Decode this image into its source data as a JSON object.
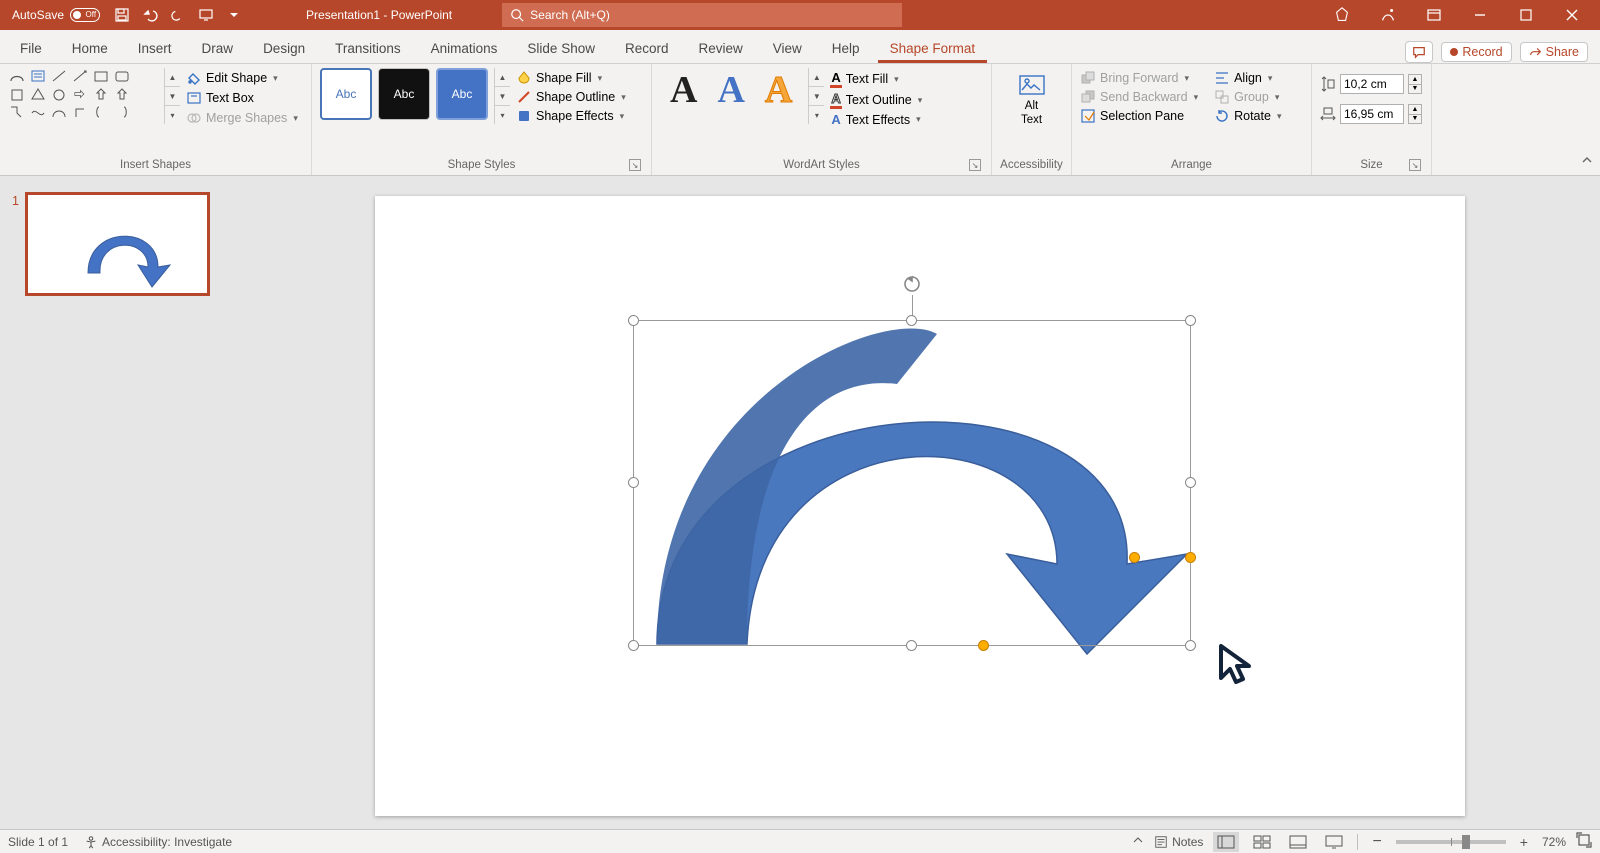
{
  "titlebar": {
    "autosave_label": "AutoSave",
    "autosave_state": "Off",
    "doc_title": "Presentation1 - PowerPoint",
    "search_placeholder": "Search (Alt+Q)"
  },
  "tabs": {
    "items": [
      "File",
      "Home",
      "Insert",
      "Draw",
      "Design",
      "Transitions",
      "Animations",
      "Slide Show",
      "Record",
      "Review",
      "View",
      "Help",
      "Shape Format"
    ],
    "active_index": 12,
    "comments_label": "",
    "record_label": "Record",
    "share_label": "Share"
  },
  "ribbon": {
    "insert_shapes": {
      "label": "Insert Shapes",
      "edit_shape": "Edit Shape",
      "text_box": "Text Box",
      "merge_shapes": "Merge Shapes"
    },
    "shape_styles": {
      "label": "Shape Styles",
      "swatch_text": "Abc",
      "shape_fill": "Shape Fill",
      "shape_outline": "Shape Outline",
      "shape_effects": "Shape Effects"
    },
    "wordart": {
      "label": "WordArt Styles",
      "text_fill": "Text Fill",
      "text_outline": "Text Outline",
      "text_effects": "Text Effects"
    },
    "accessibility": {
      "label": "Accessibility",
      "alt_text_1": "Alt",
      "alt_text_2": "Text"
    },
    "arrange": {
      "label": "Arrange",
      "bring_forward": "Bring Forward",
      "send_backward": "Send Backward",
      "selection_pane": "Selection Pane",
      "align": "Align",
      "group": "Group",
      "rotate": "Rotate"
    },
    "size": {
      "label": "Size",
      "height": "10,2 cm",
      "width": "16,95 cm"
    }
  },
  "thumbs": {
    "slide1_num": "1"
  },
  "status": {
    "slide_info": "Slide 1 of 1",
    "accessibility": "Accessibility: Investigate",
    "notes": "Notes",
    "zoom": "72%"
  }
}
